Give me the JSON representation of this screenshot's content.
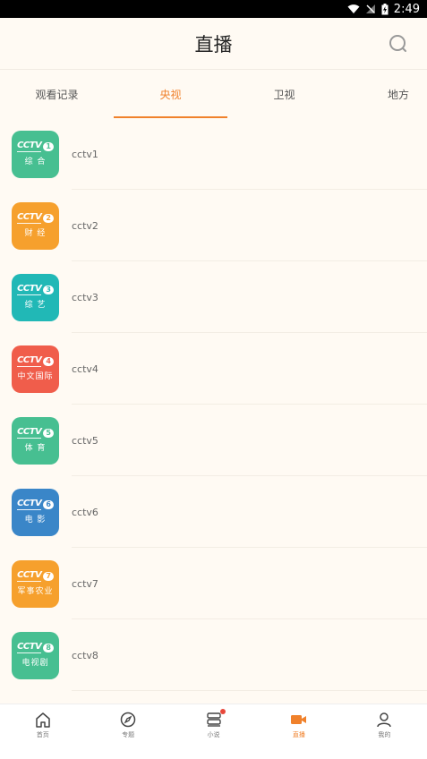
{
  "status_bar": {
    "time": "2:49"
  },
  "header": {
    "title": "直播"
  },
  "tabs": [
    {
      "label": "观看记录"
    },
    {
      "label": "央视"
    },
    {
      "label": "卫视"
    },
    {
      "label": "地方"
    }
  ],
  "channels": [
    {
      "name": "cctv1",
      "num": "1",
      "sub": "综 合",
      "color": "#47bf91"
    },
    {
      "name": "cctv2",
      "num": "2",
      "sub": "财 经",
      "color": "#f6a02d"
    },
    {
      "name": "cctv3",
      "num": "3",
      "sub": "综 艺",
      "color": "#21b8b6"
    },
    {
      "name": "cctv4",
      "num": "4",
      "sub": "中文国际",
      "color": "#f05d4b"
    },
    {
      "name": "cctv5",
      "num": "5",
      "sub": "体 育",
      "color": "#47bf91"
    },
    {
      "name": "cctv6",
      "num": "6",
      "sub": "电 影",
      "color": "#3a86c8"
    },
    {
      "name": "cctv7",
      "num": "7",
      "sub": "军事农业",
      "color": "#f6a02d"
    },
    {
      "name": "cctv8",
      "num": "8",
      "sub": "电视剧",
      "color": "#47bf91"
    }
  ],
  "logo_brand": "CCTV",
  "bottom_nav": [
    {
      "label": "首页",
      "icon": "home-icon"
    },
    {
      "label": "专题",
      "icon": "compass-icon"
    },
    {
      "label": "小说",
      "icon": "book-icon"
    },
    {
      "label": "直播",
      "icon": "video-camera-icon"
    },
    {
      "label": "我的",
      "icon": "user-icon"
    }
  ],
  "accent_color": "#f0812b"
}
